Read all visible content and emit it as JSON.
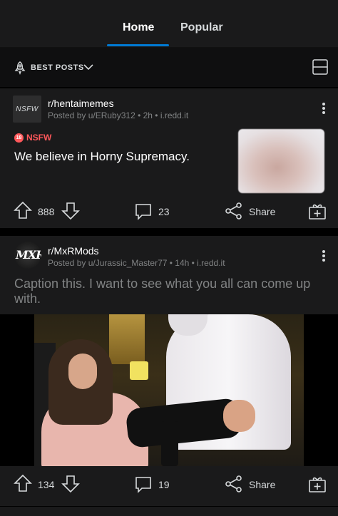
{
  "tabs": {
    "home": "Home",
    "popular": "Popular"
  },
  "sort": {
    "label": "BEST POSTS"
  },
  "colors": {
    "accent": "#0079d3",
    "nsfw": "#ff585b",
    "background": "#1a1a1b"
  },
  "posts": [
    {
      "avatar_text": "NSFW",
      "subreddit": "r/hentaimemes",
      "meta": "Posted by u/ERuby312 • 2h • i.redd.it",
      "nsfw_badge": "18",
      "nsfw_label": "NSFW",
      "title": "We believe in Horny Supremacy.",
      "upvotes": "888",
      "comments": "23",
      "share": "Share"
    },
    {
      "avatar_text": "MXR",
      "subreddit": "r/MxRMods",
      "meta": "Posted by u/Jurassic_Master77 • 14h • i.redd.it",
      "title": "Caption this. I want to see what you all can come up with.",
      "upvotes": "134",
      "comments": "19",
      "share": "Share"
    }
  ]
}
